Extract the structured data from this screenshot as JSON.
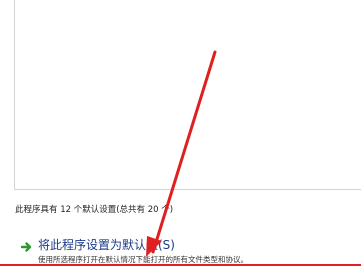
{
  "summary_text": "此程序具有 12 个默认设置(总共有 20 个)",
  "default_option": {
    "title": "将此程序设置为默认值(S)",
    "description": "使用所选程序打开在默认情况下能打开的所有文件类型和协议。",
    "icon": "green-arrow-icon"
  },
  "colors": {
    "annotation": "#e02020",
    "option_title": "#1a3a8a",
    "icon": "#2e9a2e"
  }
}
